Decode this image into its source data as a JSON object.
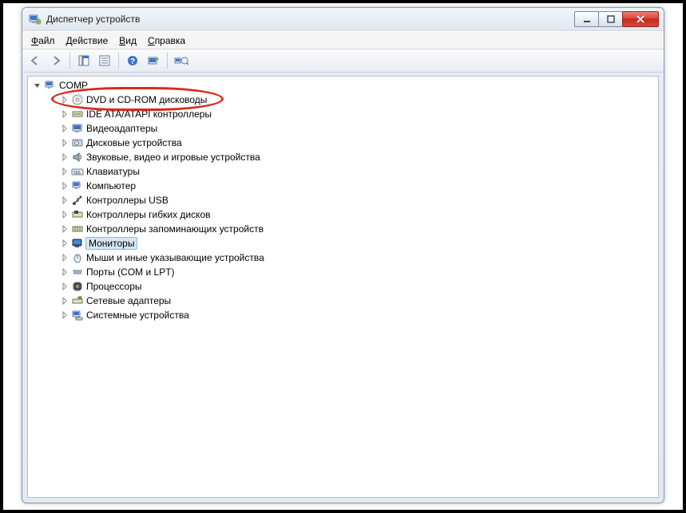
{
  "window": {
    "title": "Диспетчер устройств"
  },
  "menu": {
    "file": "Файл",
    "action": "Действие",
    "view": "Вид",
    "help": "Справка",
    "file_u": "Ф",
    "action_u": "Д",
    "view_u": "В",
    "help_u": "С"
  },
  "tree": {
    "root": "COMP",
    "items": [
      {
        "label": "DVD и CD-ROM дисководы",
        "icon": "disc",
        "highlighted": true
      },
      {
        "label": "IDE ATA/ATAPI контроллеры",
        "icon": "ide"
      },
      {
        "label": "Видеоадаптеры",
        "icon": "display"
      },
      {
        "label": "Дисковые устройства",
        "icon": "hdd"
      },
      {
        "label": "Звуковые, видео и игровые устройства",
        "icon": "sound"
      },
      {
        "label": "Клавиатуры",
        "icon": "keyboard"
      },
      {
        "label": "Компьютер",
        "icon": "computer"
      },
      {
        "label": "Контроллеры USB",
        "icon": "usb"
      },
      {
        "label": "Контроллеры гибких дисков",
        "icon": "floppyctl"
      },
      {
        "label": "Контроллеры запоминающих устройств",
        "icon": "storage"
      },
      {
        "label": "Мониторы",
        "icon": "monitor",
        "selected": true
      },
      {
        "label": "Мыши и иные указывающие устройства",
        "icon": "mouse"
      },
      {
        "label": "Порты (COM и LPT)",
        "icon": "ports"
      },
      {
        "label": "Процессоры",
        "icon": "cpu"
      },
      {
        "label": "Сетевые адаптеры",
        "icon": "network"
      },
      {
        "label": "Системные устройства",
        "icon": "system"
      }
    ]
  }
}
